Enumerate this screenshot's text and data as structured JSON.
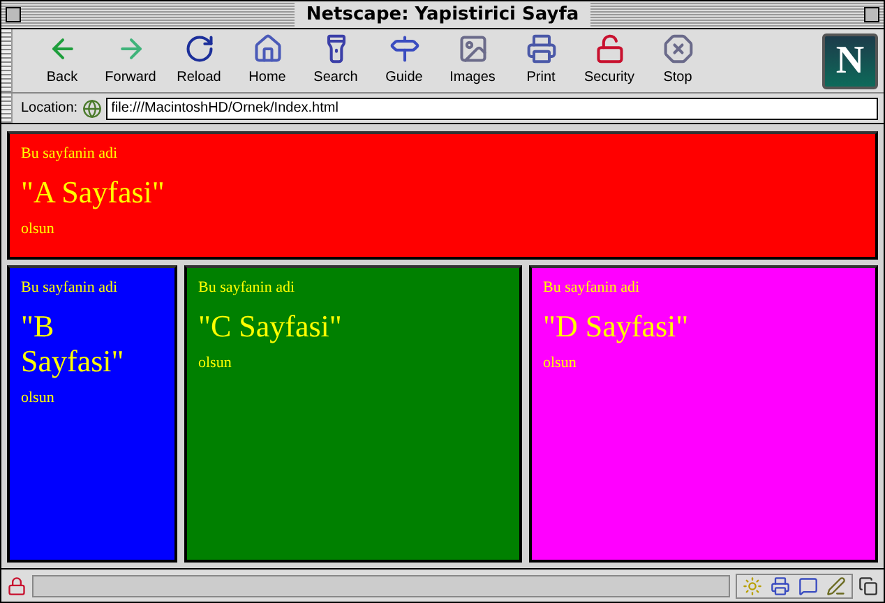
{
  "window": {
    "title": "Netscape: Yapistirici Sayfa"
  },
  "toolbar": {
    "buttons": [
      {
        "label": "Back",
        "kind": "back"
      },
      {
        "label": "Forward",
        "kind": "forward"
      },
      {
        "label": "Reload",
        "kind": "reload"
      },
      {
        "label": "Home",
        "kind": "home"
      },
      {
        "label": "Search",
        "kind": "search"
      },
      {
        "label": "Guide",
        "kind": "guide"
      },
      {
        "label": "Images",
        "kind": "images"
      },
      {
        "label": "Print",
        "kind": "print"
      },
      {
        "label": "Security",
        "kind": "security"
      },
      {
        "label": "Stop",
        "kind": "stop"
      }
    ],
    "logo": "N"
  },
  "location": {
    "label": "Location:",
    "value": "file:///MacintoshHD/Ornek/Index.html"
  },
  "frame_rows": [
    {
      "frames": [
        {
          "caption": "Bu sayfanin adi",
          "title": "\"A Sayfasi\"",
          "footer": "olsun",
          "color": "#ff0000"
        }
      ]
    },
    {
      "frames": [
        {
          "caption": "Bu sayfanin adi",
          "title": "\"B Sayfasi\"",
          "footer": "olsun",
          "color": "#0000ff"
        },
        {
          "caption": "Bu sayfanin adi",
          "title": "\"C Sayfasi\"",
          "footer": "olsun",
          "color": "#008000"
        },
        {
          "caption": "Bu sayfanin adi",
          "title": "\"D Sayfasi\"",
          "footer": "olsun",
          "color": "#ff00ff"
        }
      ]
    }
  ]
}
